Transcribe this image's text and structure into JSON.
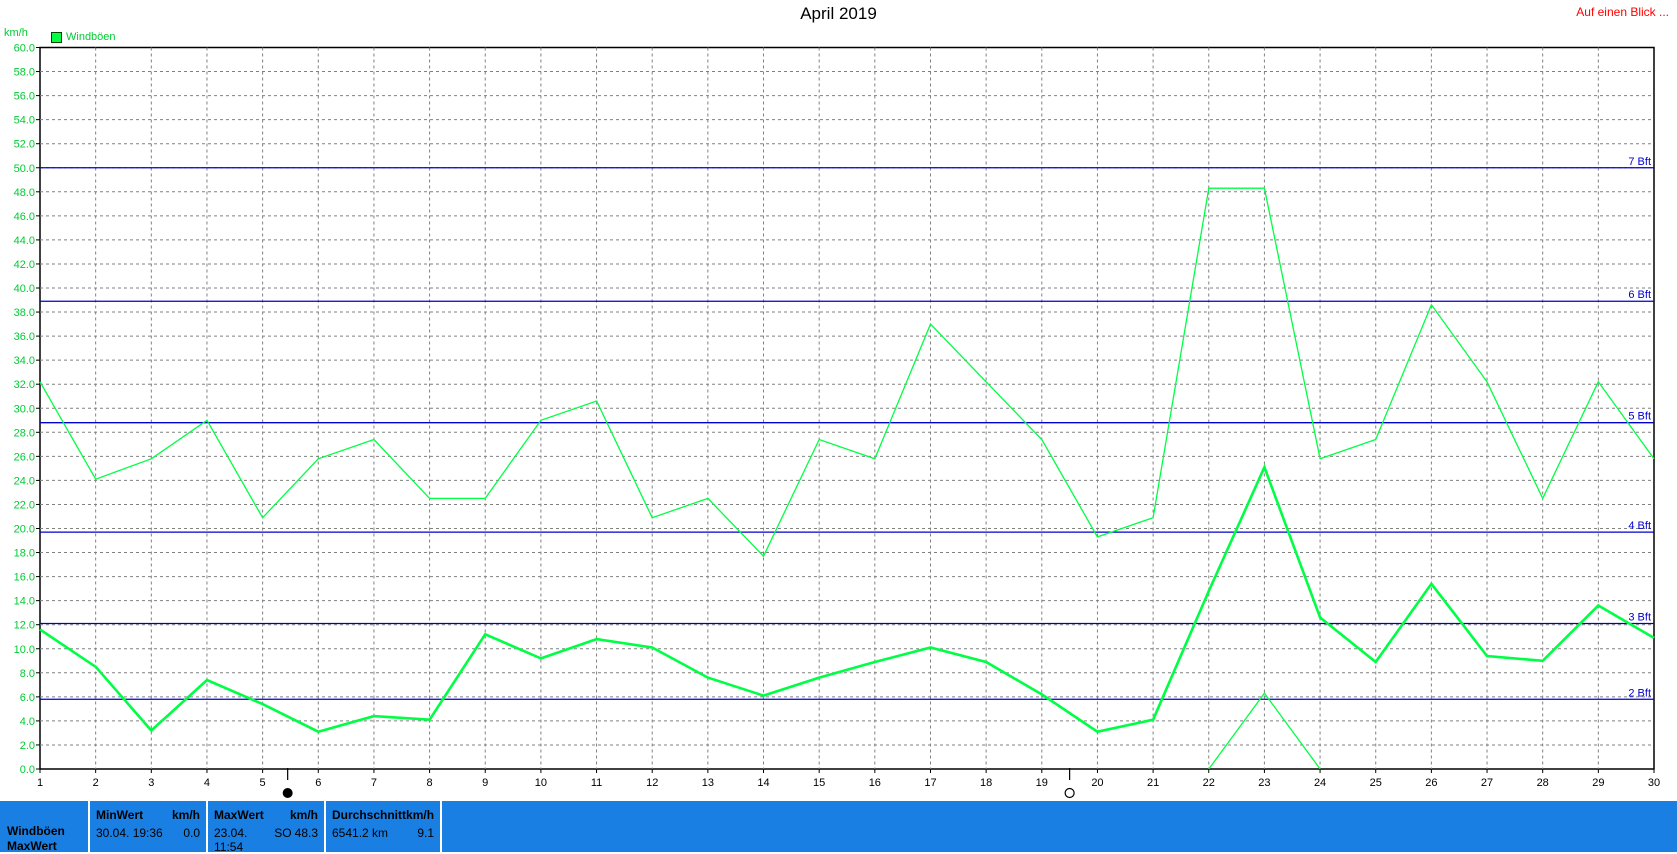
{
  "page_title": "April 2019",
  "overview_link": "Auf einen Blick ...",
  "unit_label": "km/h",
  "legend_label": "Windböen",
  "colors": {
    "series": "#00ff44",
    "bft_lines": "#0000cc",
    "grid": "#808080",
    "stats_bar": "#1a7fe3",
    "link": "#ff0000"
  },
  "moon_phases": [
    {
      "day": 5.45,
      "icon": "full-moon-icon"
    },
    {
      "day": 19.5,
      "icon": "new-moon-icon"
    }
  ],
  "chart_data": {
    "type": "line",
    "title": "April 2019",
    "ylabel": "km/h",
    "ylim": [
      0,
      60
    ],
    "xlim": [
      1,
      30
    ],
    "y_ticks": [
      "0.0",
      "2.0",
      "4.0",
      "6.0",
      "8.0",
      "10.0",
      "12.0",
      "14.0",
      "16.0",
      "18.0",
      "20.0",
      "22.0",
      "24.0",
      "26.0",
      "28.0",
      "30.0",
      "32.0",
      "34.0",
      "36.0",
      "38.0",
      "40.0",
      "42.0",
      "44.0",
      "46.0",
      "48.0",
      "50.0",
      "52.0",
      "54.0",
      "56.0",
      "58.0",
      "60.0"
    ],
    "x_ticks": [
      "1",
      "2",
      "3",
      "4",
      "5",
      "6",
      "7",
      "8",
      "9",
      "10",
      "11",
      "12",
      "13",
      "14",
      "15",
      "16",
      "17",
      "18",
      "19",
      "20",
      "21",
      "22",
      "23",
      "24",
      "25",
      "26",
      "27",
      "28",
      "29",
      "30"
    ],
    "grid": true,
    "legend_position": "top-left",
    "reference_lines": [
      {
        "label": "2 Bft",
        "value": 5.8
      },
      {
        "label": "3 Bft",
        "value": 12.1
      },
      {
        "label": "4 Bft",
        "value": 19.7
      },
      {
        "label": "5 Bft",
        "value": 28.8
      },
      {
        "label": "6 Bft",
        "value": 38.9
      },
      {
        "label": "7 Bft",
        "value": 50.0
      }
    ],
    "series": [
      {
        "name": "Windböen",
        "role": "max",
        "x": [
          1,
          2,
          3,
          4,
          5,
          6,
          7,
          8,
          9,
          10,
          11,
          12,
          13,
          14,
          15,
          16,
          17,
          18,
          19,
          20,
          21,
          22,
          23,
          24,
          25,
          26,
          27,
          28,
          29,
          30
        ],
        "values": [
          32.2,
          24.1,
          25.8,
          29.0,
          20.9,
          25.8,
          27.4,
          22.5,
          22.5,
          29.0,
          30.6,
          20.9,
          22.5,
          17.7,
          27.4,
          25.8,
          37.0,
          32.2,
          27.4,
          19.3,
          20.9,
          48.3,
          48.3,
          25.8,
          27.4,
          38.6,
          32.2,
          22.5,
          32.2,
          25.8
        ]
      },
      {
        "role": "average",
        "x": [
          1,
          2,
          3,
          4,
          5,
          6,
          7,
          8,
          9,
          10,
          11,
          12,
          13,
          14,
          15,
          16,
          17,
          18,
          19,
          20,
          21,
          22,
          23,
          24,
          25,
          26,
          27,
          28,
          29,
          30
        ],
        "values": [
          11.6,
          8.5,
          3.2,
          7.4,
          5.4,
          3.1,
          4.4,
          4.1,
          11.2,
          9.2,
          10.8,
          10.1,
          7.6,
          6.1,
          7.6,
          8.9,
          10.1,
          8.9,
          6.2,
          3.1,
          4.1,
          14.8,
          25.1,
          12.6,
          8.9,
          15.4,
          9.4,
          9.0,
          13.6,
          10.9
        ]
      },
      {
        "role": "min",
        "x": [
          22,
          23,
          24
        ],
        "values": [
          0.0,
          6.3,
          0.0
        ]
      }
    ]
  },
  "stats": {
    "row_label_top": "Windböen",
    "row_label_bottom": "MaxWert",
    "min": {
      "header": "MinWert",
      "unit": "km/h",
      "datetime": "30.04.  19:36",
      "value": "0.0"
    },
    "max": {
      "header": "MaxWert",
      "unit": "km/h",
      "datetime": "23.04.  11:54",
      "direction": "SO",
      "value": "48.3"
    },
    "avg": {
      "header": "Durchschnitt",
      "unit": "km/h",
      "distance": "6541.2 km",
      "value": "9.1"
    }
  }
}
